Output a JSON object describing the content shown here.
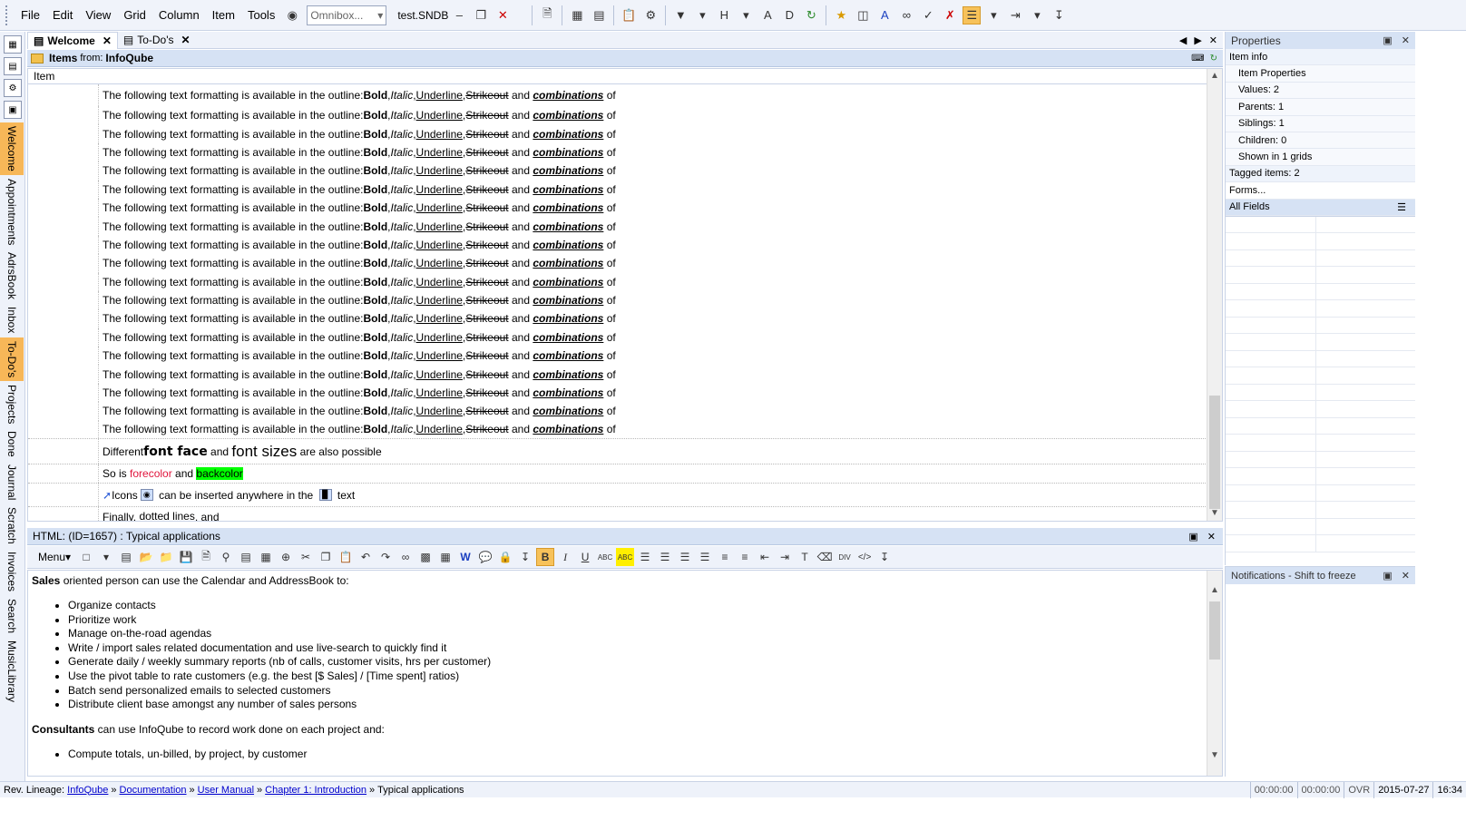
{
  "menu": [
    "File",
    "Edit",
    "View",
    "Grid",
    "Column",
    "Item",
    "Tools"
  ],
  "omnibox_placeholder": "Omnibox...",
  "database_name": "test.SNDB",
  "tabs": [
    {
      "label": "Welcome",
      "active": true
    },
    {
      "label": "To-Do's",
      "active": false
    }
  ],
  "sidebar_tabs": [
    "Welcome",
    "Appointments",
    "AdrsBook",
    "Inbox",
    "To-Do's",
    "Projects",
    "Done",
    "Journal",
    "Scratch",
    "Invoices",
    "Search",
    "MusicLibrary"
  ],
  "items_header": {
    "prefix": "Items",
    "from": "from:",
    "source": "InfoQube"
  },
  "grid": {
    "column_header": "Item",
    "formatting_row": {
      "text": "The following text formatting is available in the outline: ",
      "bold": "Bold",
      "italic": "Italic",
      "underline": "Underline",
      "strike": "Strikeout",
      "and": "and",
      "combo": "combinations",
      "of": "of",
      "comma": ", "
    },
    "font_row": {
      "before": "Different ",
      "face": "font face",
      "mid": " and ",
      "sizes": "font sizes",
      "after": " are also possible"
    },
    "color_row": {
      "before": "So is ",
      "fore": "forecolor",
      "mid": " and ",
      "back": "backcolor"
    },
    "icons_row": {
      "a": "Icons",
      "b": " can be inserted anywhere in the ",
      "c": " text"
    },
    "final_row": {
      "before": "Finally, ",
      "dotted": "dotted lines",
      "after": ", and"
    }
  },
  "html_editor": {
    "title": "HTML: (ID=1657) : Typical applications",
    "menu_label": "Menu",
    "para1_bold": "Sales",
    "para1_rest": " oriented person can use the Calendar and AddressBook to:",
    "list1": [
      "Organize contacts",
      "Prioritize work",
      "Manage on-the-road agendas",
      "Write / import sales related documentation and use live-search to quickly find it",
      "Generate daily / weekly summary reports (nb of calls, customer visits, hrs per customer)",
      "Use the pivot table to rate customers (e.g. the best [$ Sales] / [Time spent] ratios)",
      "Batch send personalized emails to selected customers",
      "Distribute client base amongst any number of sales persons"
    ],
    "para2_bold": "Consultants",
    "para2_rest": " can use InfoQube to record work done on each project and:",
    "list2": [
      "Compute totals, un-billed, by project, by customer"
    ]
  },
  "properties": {
    "title": "Properties",
    "item_info": "Item info",
    "item_properties": "Item Properties",
    "values": "Values: 2",
    "parents": "Parents: 1",
    "siblings": "Siblings: 1",
    "children": "Children: 0",
    "shown_in": "Shown in 1 grids",
    "tagged": "Tagged items: 2",
    "forms": "Forms...",
    "all_fields": "All Fields"
  },
  "notifications": {
    "title": "Notifications - Shift to freeze"
  },
  "statusbar": {
    "prefix": "Rev. Lineage:",
    "crumbs": [
      "InfoQube",
      "Documentation",
      "User Manual",
      "Chapter 1: Introduction"
    ],
    "current": "Typical applications",
    "time1": "00:00:00",
    "time2": "00:00:00",
    "ovr": "OVR",
    "date": "2015-07-27",
    "clock": "16:34"
  },
  "colors": {
    "accent": "#f7b758",
    "header": "#d6e2f4",
    "link": "#0000cc",
    "fore": "#e0143c",
    "back": "#00ff00"
  }
}
